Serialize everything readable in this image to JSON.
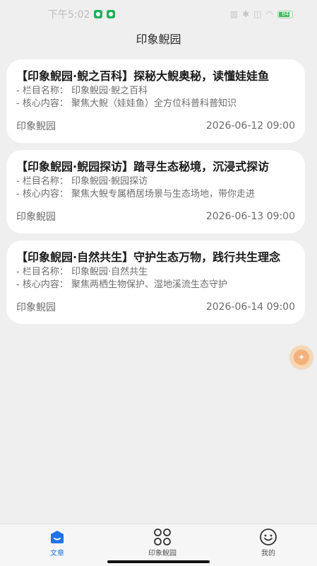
{
  "status": {
    "time": "下午5:02",
    "battery": "84"
  },
  "header": {
    "title": "印象鲵园"
  },
  "cards": [
    {
      "title": "【印象鲵园·鲵之百科】探秘大鲵奥秘，读懂娃娃鱼",
      "column": "- 栏目名称： 印象鲵园·鲵之百科",
      "content": "- 核心内容： 聚焦大鲵（娃娃鱼）全方位科普科普知识",
      "source": "印象鲵园",
      "date": "2026-06-12 09:00"
    },
    {
      "title": "【印象鲵园·鲵园探访】踏寻生态秘境，沉浸式探访",
      "column": "- 栏目名称： 印象鲵园·鲵园探访",
      "content": "- 核心内容： 聚焦大鲵专属栖居场景与生态场地，带你走进",
      "source": "印象鲵园",
      "date": "2026-06-13 09:00"
    },
    {
      "title": "【印象鲵园·自然共生】守护生态万物，践行共生理念",
      "column": "- 栏目名称： 印象鲵园·自然共生",
      "content": "- 核心内容： 聚焦两栖生物保护、湿地溪流生态守护",
      "source": "印象鲵园",
      "date": "2026-06-14 09:00"
    }
  ],
  "tabs": [
    {
      "label": "文章",
      "icon": "article-icon",
      "active": true
    },
    {
      "label": "印象鲵园",
      "icon": "grid-icon",
      "active": false
    },
    {
      "label": "我的",
      "icon": "smile-icon",
      "active": false
    }
  ],
  "colors": {
    "accent": "#1e73e8",
    "background": "#efefef",
    "card": "#ffffff",
    "float": "#f4b17c"
  }
}
